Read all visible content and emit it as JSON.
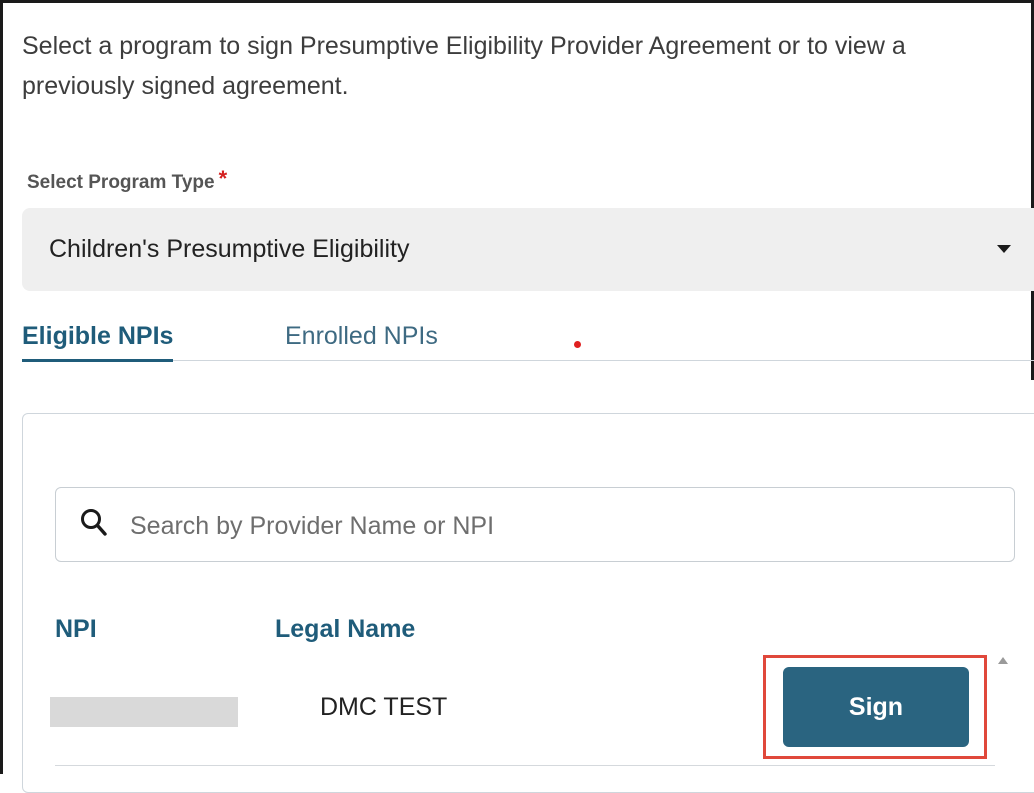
{
  "intro_text": "Select a program to sign Presumptive Eligibility Provider Agreement or to view a previously signed agreement.",
  "program_select": {
    "label": "Select Program Type",
    "required_marker": "*",
    "selected_value": "Children's Presumptive Eligibility"
  },
  "tabs": [
    {
      "label": "Eligible NPIs",
      "active": true
    },
    {
      "label": "Enrolled NPIs",
      "active": false
    }
  ],
  "search": {
    "placeholder": "Search by Provider Name or NPI",
    "value": "",
    "icon": "search-icon"
  },
  "table": {
    "columns": [
      "NPI",
      "Legal Name"
    ],
    "rows": [
      {
        "npi": "",
        "legal_name": "DMC TEST",
        "action_label": "Sign"
      }
    ]
  },
  "colors": {
    "accent": "#1f5c7a",
    "button": "#2a6480",
    "highlight": "#e0483b",
    "required": "#d42020"
  }
}
